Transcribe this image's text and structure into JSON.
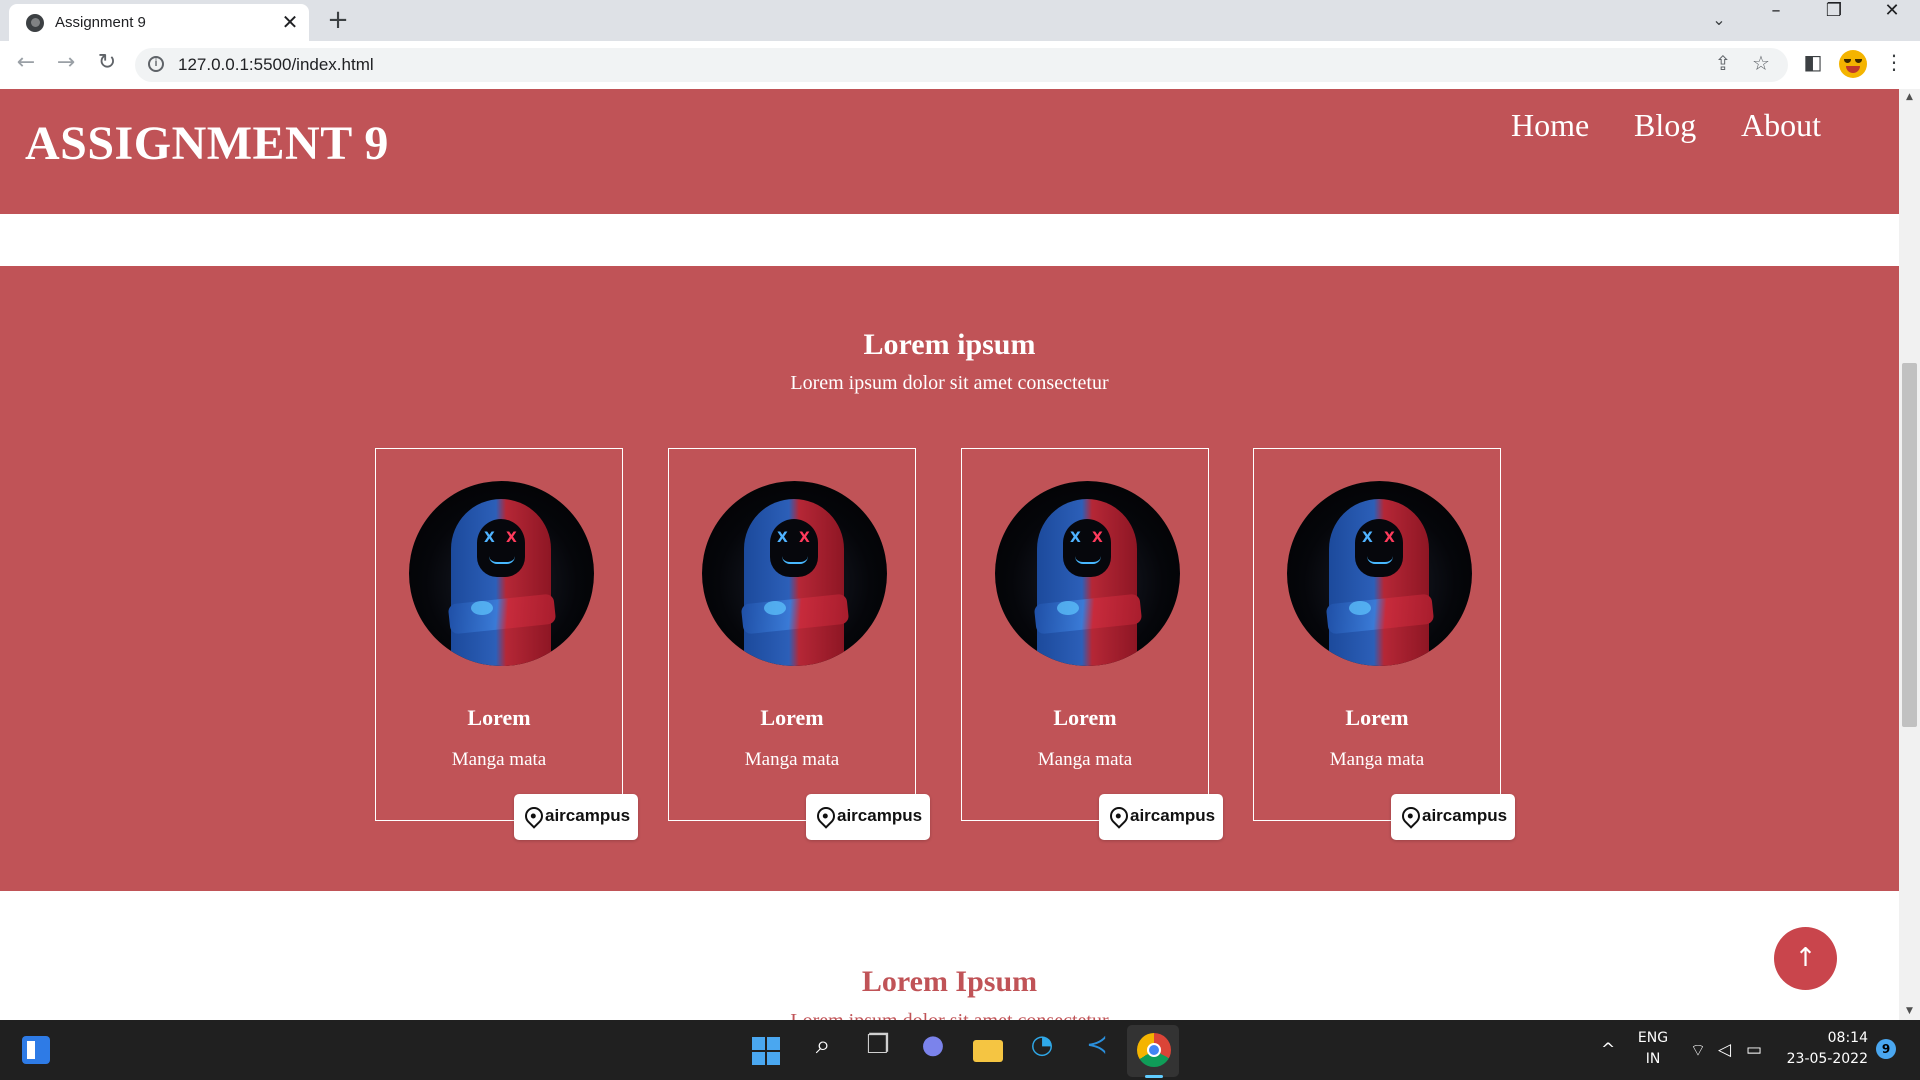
{
  "browser": {
    "tab_title": "Assignment 9",
    "url": "127.0.0.1:5500/index.html",
    "new_tab_label": "+",
    "close_label": "✕"
  },
  "site": {
    "brand": "ASSIGNMENT 9",
    "nav": [
      "Home",
      "Blog",
      "About"
    ]
  },
  "team_section": {
    "title": "Lorem ipsum",
    "subtitle": "Lorem ipsum dolor sit amet consectetur",
    "cards": [
      {
        "name": "Lorem",
        "role": "Manga mata",
        "badge": "aircampus"
      },
      {
        "name": "Lorem",
        "role": "Manga mata",
        "badge": "aircampus"
      },
      {
        "name": "Lorem",
        "role": "Manga mata",
        "badge": "aircampus"
      },
      {
        "name": "Lorem",
        "role": "Manga mata",
        "badge": "aircampus"
      }
    ]
  },
  "next_section": {
    "title": "Lorem Ipsum",
    "subtitle": "Lorem ipsum dolor sit amet consectetur"
  },
  "scroll_top_label": "↑",
  "taskbar": {
    "language": "ENG",
    "region": "IN",
    "time": "08:14",
    "date": "23-05-2022",
    "notification_count": "9"
  },
  "colors": {
    "brand_red": "#c05357",
    "scroll_button": "#c9454c"
  }
}
